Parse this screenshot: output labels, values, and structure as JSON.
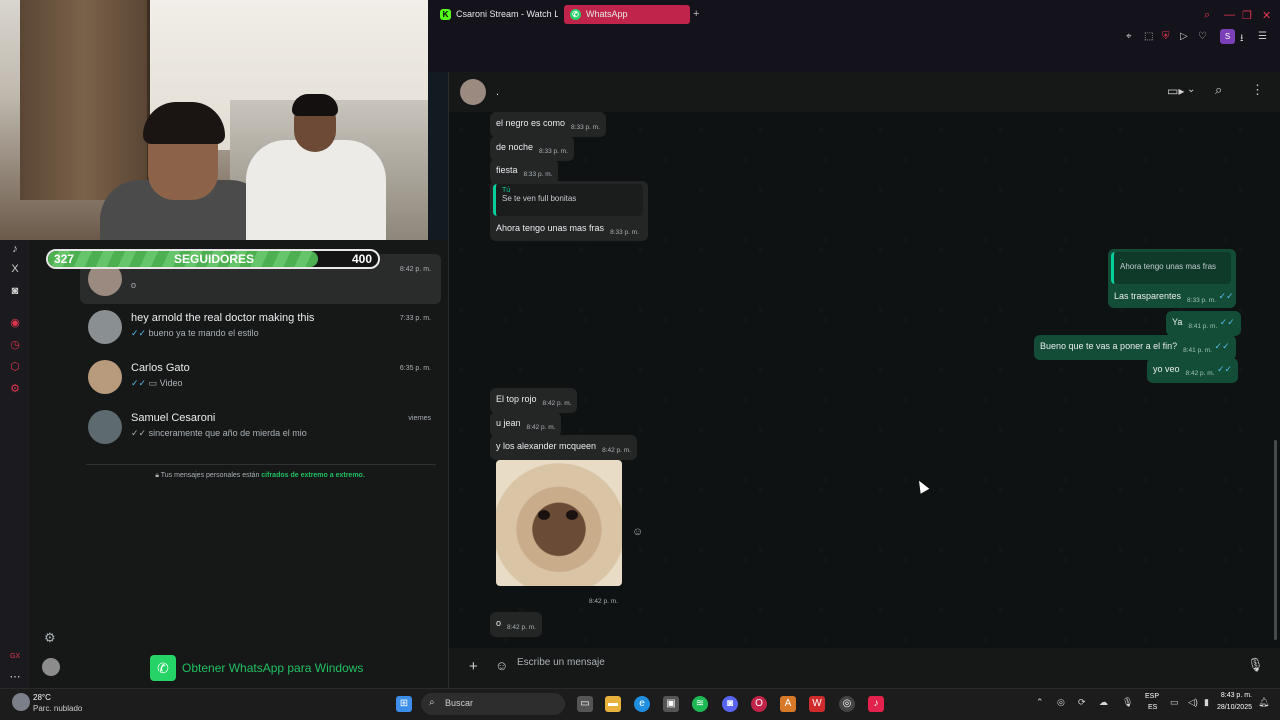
{
  "followers": {
    "current": "327",
    "label": "SEGUIDORES",
    "goal": "400",
    "progress": 0.817
  },
  "browser": {
    "tabs": [
      {
        "label": "Csaroni Stream - Watch L",
        "icon": "K"
      },
      {
        "label": "WhatsApp",
        "icon": "W"
      }
    ],
    "profile_initial": "S"
  },
  "chat_list": [
    {
      "name": "",
      "preview": "o",
      "time": "8:42 p. m."
    },
    {
      "name": "hey arnold the real doctor making this",
      "preview": "bueno ya te mando el estilo",
      "time": "7:33 p. m."
    },
    {
      "name": "Carlos Gato",
      "preview": "Video",
      "time": "6:35 p. m."
    },
    {
      "name": "Samuel Cesaroni",
      "preview": "sinceramente que año de mierda el mio",
      "time": "viernes"
    }
  ],
  "encryption": {
    "text": "Tus mensajes personales están ",
    "link": "cifrados de extremo a extremo."
  },
  "get_app": "Obtener WhatsApp para Windows",
  "chat_header": {
    "name": "."
  },
  "messages": {
    "m1": {
      "text": "el negro es como",
      "time": "8:33 p. m."
    },
    "m2": {
      "text": "de noche",
      "time": "8:33 p. m."
    },
    "m3": {
      "text": "fiesta",
      "time": "8:33 p. m."
    },
    "q1": {
      "name": "Tú",
      "text": "Se te ven full bonitas"
    },
    "m4": {
      "text": "Ahora tengo unas mas fras",
      "time": "8:33 p. m."
    },
    "q2": {
      "name": ".",
      "text": "Ahora tengo unas mas fras"
    },
    "o1": {
      "text": "Las trasparentes",
      "time": "8:33 p. m."
    },
    "o2": {
      "text": "Ya",
      "time": "8:41 p. m."
    },
    "o3": {
      "text": "Bueno que te vas a poner a el fin?",
      "time": "8:41 p. m."
    },
    "o4": {
      "text": "yo veo",
      "time": "8:42 p. m."
    },
    "m5": {
      "text": "El top rojo",
      "time": "8:42 p. m."
    },
    "m6": {
      "text": "u jean",
      "time": "8:42 p. m."
    },
    "m7": {
      "text": "y los alexander mcqueen",
      "time": "8:42 p. m."
    },
    "img_time": "8:42 p. m.",
    "m8": {
      "text": "o",
      "time": "8:42 p. m."
    }
  },
  "composer": {
    "placeholder": "Escribe un mensaje"
  },
  "taskbar": {
    "weather_temp": "28°C",
    "weather_desc": "Parc. nublado",
    "search": "Buscar",
    "lang1": "ESP",
    "lang2": "ES",
    "time": "8:43 p. m.",
    "date": "28/10/2025"
  },
  "side_label_gx": "GX"
}
